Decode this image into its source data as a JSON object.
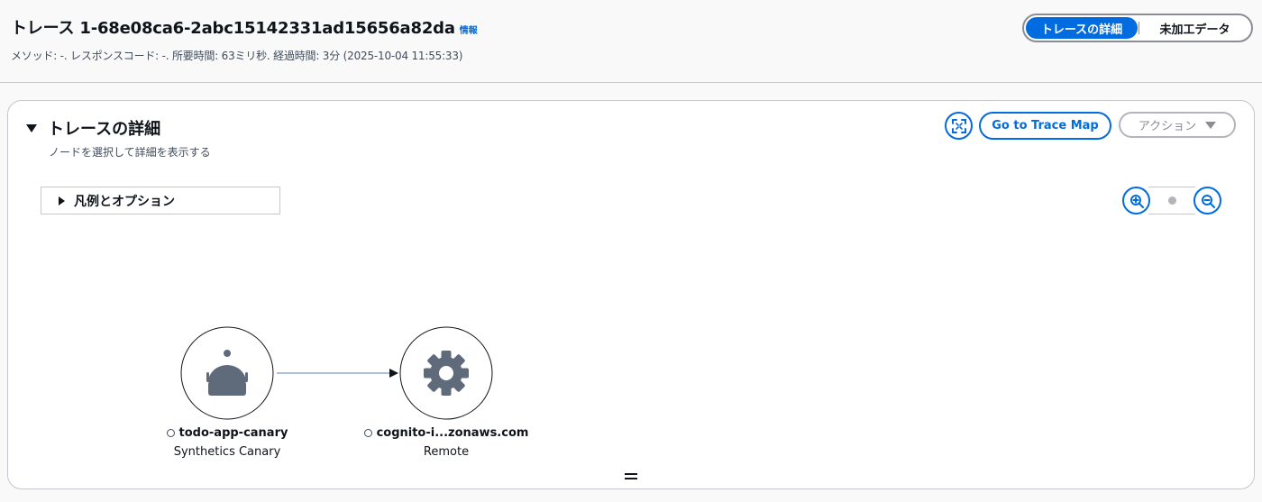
{
  "header": {
    "title": "トレース 1-68e08ca6-2abc15142331ad15656a82da",
    "info_link": "情報",
    "meta": "メソッド: -. レスポンスコード: -. 所要時間: 63ミリ秒. 経過時間: 3分 (2025-10-04 11:55:33)",
    "tabs": [
      {
        "label": "トレースの詳細",
        "active": true
      },
      {
        "label": "未加工データ",
        "active": false
      }
    ]
  },
  "panel": {
    "title": "トレースの詳細",
    "description": "ノードを選択して詳細を表示する",
    "fullscreen_icon": "fullscreen-icon",
    "trace_map_label": "Go to Trace Map",
    "action_label": "アクション",
    "legend_label": "凡例とオプション"
  },
  "graph": {
    "nodes": [
      {
        "name": "todo-app-canary",
        "type": "Synthetics Canary",
        "icon": "canary-icon"
      },
      {
        "name": "cognito-i...zonaws.com",
        "type": "Remote",
        "icon": "gear-icon"
      }
    ],
    "edge_color": "#5b7fb5"
  },
  "colors": {
    "accent": "#006ce0",
    "node_icon": "#5f6b7a"
  }
}
